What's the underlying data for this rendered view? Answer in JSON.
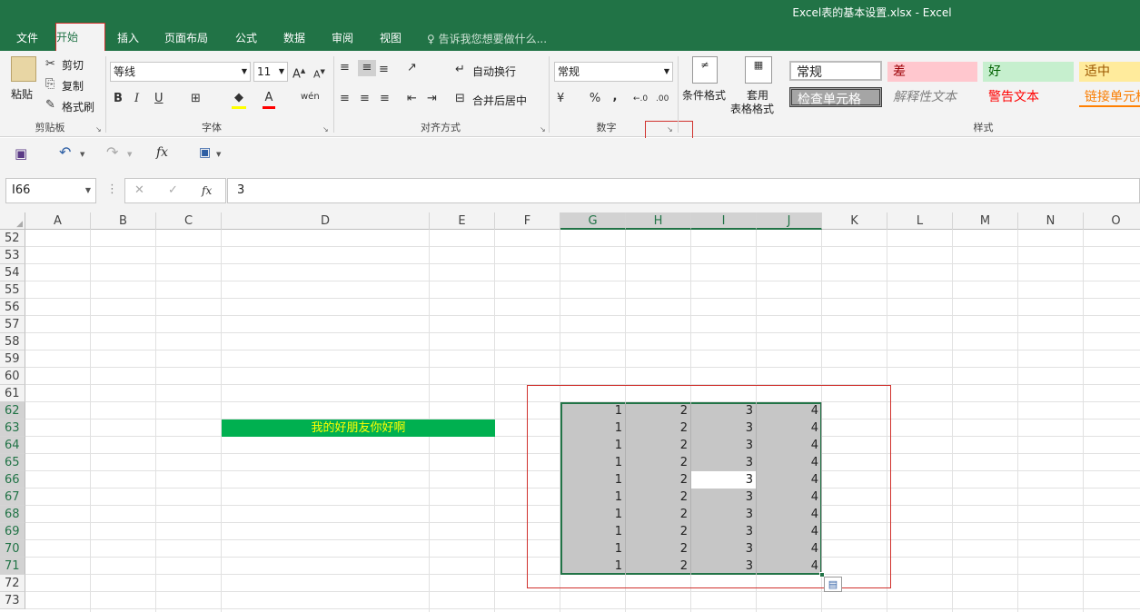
{
  "window": {
    "title": "Excel表的基本设置.xlsx - Excel"
  },
  "tabs": [
    "文件",
    "开始",
    "插入",
    "页面布局",
    "公式",
    "数据",
    "审阅",
    "视图"
  ],
  "tell_me": "告诉我您想要做什么...",
  "clipboard": {
    "paste": "粘贴",
    "cut": "剪切",
    "copy": "复制",
    "format_painter": "格式刷",
    "label": "剪贴板"
  },
  "font": {
    "name": "等线",
    "size": "11",
    "bold": "B",
    "italic": "I",
    "underline": "U",
    "phonetic": "wén",
    "label": "字体"
  },
  "alignment": {
    "wrap": "自动换行",
    "merge": "合并后居中",
    "label": "对齐方式"
  },
  "number": {
    "format": "常规",
    "percent": "%",
    "comma": ",",
    "label": "数字"
  },
  "styles": {
    "cond_format": "条件格式",
    "table_format_1": "套用",
    "table_format_2": "表格格式",
    "normal": "常规",
    "bad": "差",
    "good": "好",
    "neutral": "适中",
    "check_cell": "检查单元格",
    "explanatory": "解释性文本",
    "warning": "警告文本",
    "linked": "链接单元格",
    "label": "样式"
  },
  "formula_bar": {
    "name_box": "I66",
    "fx": "fx",
    "value": "3"
  },
  "columns": [
    "A",
    "B",
    "C",
    "D",
    "E",
    "F",
    "G",
    "H",
    "I",
    "J",
    "K",
    "L",
    "M",
    "N",
    "O"
  ],
  "rows": [
    "52",
    "53",
    "54",
    "55",
    "56",
    "57",
    "58",
    "59",
    "60",
    "61",
    "62",
    "63",
    "64",
    "65",
    "66",
    "67",
    "68",
    "69",
    "70",
    "71",
    "72",
    "73"
  ],
  "merged_text": "我的好朋友你好啊",
  "selection_rows": [
    [
      "1",
      "2",
      "3",
      "4"
    ],
    [
      "1",
      "2",
      "3",
      "4"
    ],
    [
      "1",
      "2",
      "3",
      "4"
    ],
    [
      "1",
      "2",
      "3",
      "4"
    ],
    [
      "1",
      "2",
      "3",
      "4"
    ],
    [
      "1",
      "2",
      "3",
      "4"
    ],
    [
      "1",
      "2",
      "3",
      "4"
    ],
    [
      "1",
      "2",
      "3",
      "4"
    ],
    [
      "1",
      "2",
      "3",
      "4"
    ],
    [
      "1",
      "2",
      "3",
      "4"
    ]
  ],
  "colors": {
    "accent": "#217346",
    "selection": "#c6c6c6",
    "merged_bg": "#00b050",
    "merged_text": "#ffff00",
    "annotation": "#d0312d"
  }
}
